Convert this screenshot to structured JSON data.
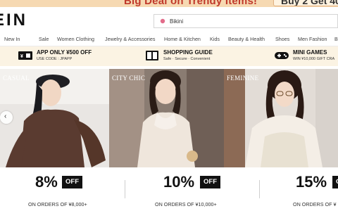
{
  "promo": {
    "text": "Big Deal on Trendy Items!",
    "cta": "Buy 2 Get 40"
  },
  "header": {
    "logo": "EIN",
    "search": {
      "value": "Bikini",
      "placeholder": ""
    }
  },
  "nav": {
    "items": [
      "New In",
      "Sale",
      "Women Clothing",
      "Jewelry & Accessories",
      "Home & Kitchen",
      "Kids",
      "Beauty & Health",
      "Shoes",
      "Men Fashion",
      "B"
    ]
  },
  "benefits": [
    {
      "title": "APP ONLY ¥500 OFF",
      "sub": "USE CODE : JPAPP",
      "icon": "app-icon"
    },
    {
      "title": "SHOPPING GUIDE",
      "sub": "Safe · Secure · Convenient",
      "icon": "book-icon"
    },
    {
      "title": "MINI GAMES",
      "sub": "WIN ¥10,000 GIFT CRA",
      "icon": "gamepad-icon"
    }
  ],
  "hero": {
    "panels": [
      {
        "tag": "CASUAL"
      },
      {
        "tag": "CITY CHIC"
      },
      {
        "tag": "FEMININE"
      }
    ]
  },
  "discounts": [
    {
      "pct": "8%",
      "off": "OFF",
      "cond": "ON ORDERS OF ¥8,000+"
    },
    {
      "pct": "10%",
      "off": "OFF",
      "cond": "ON ORDERS OF ¥10,000+"
    },
    {
      "pct": "15%",
      "off": "OFF",
      "cond": "ON ORDERS OF ¥"
    }
  ],
  "colors": {
    "promo_bg": "#f6d9b2",
    "promo_text": "#c0392b",
    "benefits_bg": "#fbf3e3",
    "off_badge": "#111111"
  }
}
